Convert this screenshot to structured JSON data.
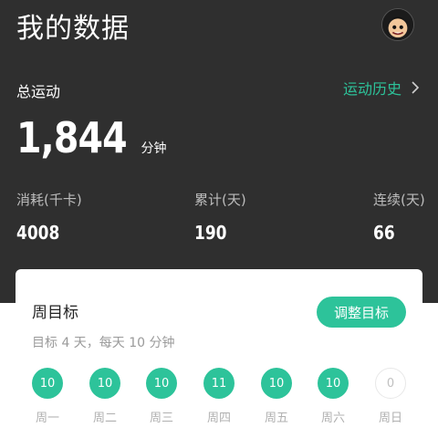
{
  "header": {
    "title": "我的数据",
    "avatar_icon": "avatar-icon"
  },
  "summary": {
    "total_label": "总运动",
    "history_link": "运动历史",
    "total_value": "1,844",
    "total_unit": "分钟"
  },
  "stats": [
    {
      "label": "消耗(千卡)",
      "value": "4008"
    },
    {
      "label": "累计(天)",
      "value": "190"
    },
    {
      "label": "连续(天)",
      "value": "66"
    }
  ],
  "weekly_goal": {
    "title": "周目标",
    "adjust_button": "调整目标",
    "subtitle": "目标 4 天，每天 10 分钟",
    "days": [
      {
        "label": "周一",
        "value": "10",
        "done": true
      },
      {
        "label": "周二",
        "value": "10",
        "done": true
      },
      {
        "label": "周三",
        "value": "10",
        "done": true
      },
      {
        "label": "周四",
        "value": "11",
        "done": true
      },
      {
        "label": "周五",
        "value": "10",
        "done": true
      },
      {
        "label": "周六",
        "value": "10",
        "done": true
      },
      {
        "label": "周日",
        "value": "0",
        "done": false
      }
    ]
  },
  "colors": {
    "accent": "#2dc39a",
    "header_bg": "#2f2f2f"
  }
}
